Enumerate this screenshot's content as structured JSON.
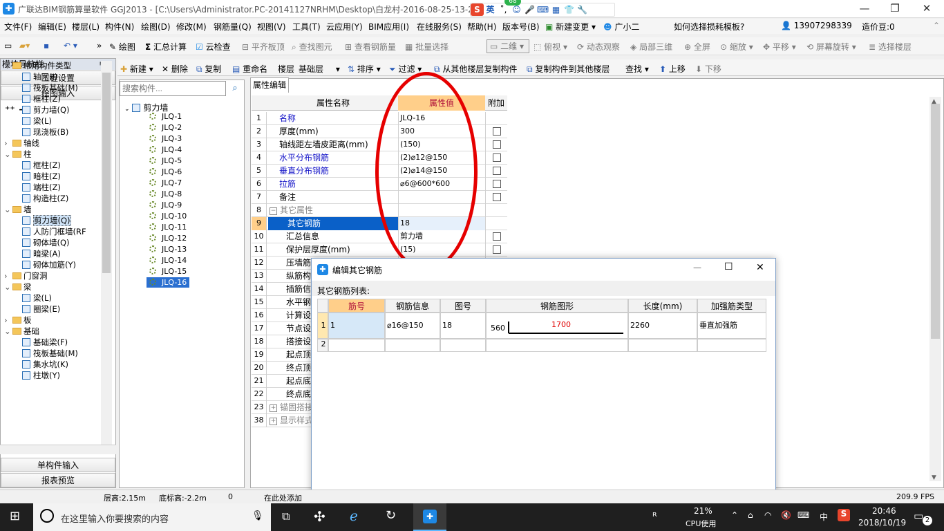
{
  "window": {
    "app_icon": "GLD-icon",
    "title": "广联达BIM钢筋算量软件 GGJ2013 - [C:\\Users\\Administrator.PC-20141127NRHM\\Desktop\\白龙村-2016-08-25-13-27",
    "min": "—",
    "restore": "❐",
    "close": "✕"
  },
  "ime": {
    "logo": "S",
    "lang": "英",
    "badge": "68"
  },
  "menu": {
    "items": [
      "文件(F)",
      "编辑(E)",
      "楼层(L)",
      "构件(N)",
      "绘图(D)",
      "修改(M)",
      "钢筋量(Q)",
      "视图(V)",
      "工具(T)",
      "云应用(Y)",
      "BIM应用(I)",
      "在线服务(S)",
      "帮助(H)",
      "版本号(B)"
    ],
    "new_change": "新建变更",
    "assistant": "广小二",
    "question": "如何选择损耗模板?",
    "phone": "13907298339",
    "price_bean": "造价豆:0"
  },
  "toolbar1": {
    "draw": "绘图",
    "sum": "汇总计算",
    "cloud_check": "云检查",
    "align_slab_top": "平齐板顶",
    "find_elem": "查找图元",
    "view_rebar": "查看钢筋量",
    "batch_select": "批量选择",
    "view_mode": "二维",
    "top_view": "俯视",
    "dynamic_view": "动态观察",
    "local_3d": "局部三维",
    "fullscreen": "全屏",
    "zoom": "缩放",
    "pan": "平移",
    "rotate": "屏幕旋转",
    "select_floor": "选择楼层"
  },
  "toolbar2": {
    "new": "新建",
    "delete": "删除",
    "copy": "复制",
    "rename": "重命名",
    "floor_label": "楼层",
    "floor_value": "基础层",
    "sort": "排序",
    "filter": "过滤",
    "copy_from_floor": "从其他楼层复制构件",
    "copy_to_floor": "复制构件到其他楼层",
    "find": "查找",
    "move_up": "上移",
    "move_down": "下移"
  },
  "nav": {
    "title": "模块导航栏",
    "pin": "ᵖ ×",
    "project_settings": "工程设置",
    "drawing_input": "绘图输入",
    "single_input": "单构件输入",
    "report_preview": "报表预览",
    "tree": [
      {
        "label": "常用构件类型",
        "level": 0,
        "type": "folder",
        "exp": "⌄"
      },
      {
        "label": "轴网(J)",
        "level": 1,
        "type": "item"
      },
      {
        "label": "筏板基础(M)",
        "level": 1,
        "type": "item"
      },
      {
        "label": "框柱(Z)",
        "level": 1,
        "type": "item"
      },
      {
        "label": "剪力墙(Q)",
        "level": 1,
        "type": "item"
      },
      {
        "label": "梁(L)",
        "level": 1,
        "type": "item"
      },
      {
        "label": "现浇板(B)",
        "level": 1,
        "type": "item"
      },
      {
        "label": "轴线",
        "level": 0,
        "type": "folder",
        "exp": "›"
      },
      {
        "label": "柱",
        "level": 0,
        "type": "folder",
        "exp": "⌄"
      },
      {
        "label": "框柱(Z)",
        "level": 1,
        "type": "item"
      },
      {
        "label": "暗柱(Z)",
        "level": 1,
        "type": "item"
      },
      {
        "label": "端柱(Z)",
        "level": 1,
        "type": "item"
      },
      {
        "label": "构造柱(Z)",
        "level": 1,
        "type": "item"
      },
      {
        "label": "墙",
        "level": 0,
        "type": "folder",
        "exp": "⌄"
      },
      {
        "label": "剪力墙(Q)",
        "level": 1,
        "type": "item",
        "selected": true
      },
      {
        "label": "人防门框墙(RF",
        "level": 1,
        "type": "item"
      },
      {
        "label": "砌体墙(Q)",
        "level": 1,
        "type": "item"
      },
      {
        "label": "暗梁(A)",
        "level": 1,
        "type": "item"
      },
      {
        "label": "砌体加筋(Y)",
        "level": 1,
        "type": "item"
      },
      {
        "label": "门窗洞",
        "level": 0,
        "type": "folder",
        "exp": "›"
      },
      {
        "label": "梁",
        "level": 0,
        "type": "folder",
        "exp": "⌄"
      },
      {
        "label": "梁(L)",
        "level": 1,
        "type": "item"
      },
      {
        "label": "圈梁(E)",
        "level": 1,
        "type": "item"
      },
      {
        "label": "板",
        "level": 0,
        "type": "folder",
        "exp": "›"
      },
      {
        "label": "基础",
        "level": 0,
        "type": "folder",
        "exp": "⌄"
      },
      {
        "label": "基础梁(F)",
        "level": 1,
        "type": "item"
      },
      {
        "label": "筏板基础(M)",
        "level": 1,
        "type": "item"
      },
      {
        "label": "集水坑(K)",
        "level": 1,
        "type": "item"
      },
      {
        "label": "柱墩(Y)",
        "level": 1,
        "type": "item"
      }
    ]
  },
  "components": {
    "search_placeholder": "搜索构件...",
    "root": "剪力墙",
    "items": [
      "JLQ-1",
      "JLQ-2",
      "JLQ-3",
      "JLQ-4",
      "JLQ-5",
      "JLQ-6",
      "JLQ-7",
      "JLQ-8",
      "JLQ-9",
      "JLQ-10",
      "JLQ-11",
      "JLQ-12",
      "JLQ-13",
      "JLQ-14",
      "JLQ-15",
      "JLQ-16"
    ],
    "selected": "JLQ-16"
  },
  "props": {
    "tab": "属性编辑",
    "col_name": "属性名称",
    "col_value": "属性值",
    "col_extra": "附加",
    "rows": [
      {
        "n": "1",
        "name": "名称",
        "value": "JLQ-16",
        "blue": true,
        "cb": false
      },
      {
        "n": "2",
        "name": "厚度(mm)",
        "value": "300",
        "cb": true
      },
      {
        "n": "3",
        "name": "轴线距左墙皮距离(mm)",
        "value": "(150)",
        "cb": true
      },
      {
        "n": "4",
        "name": "水平分布钢筋",
        "value": "(2)⌀12@150",
        "blue": true,
        "cb": true
      },
      {
        "n": "5",
        "name": "垂直分布钢筋",
        "value": "(2)⌀14@150",
        "blue": true,
        "cb": true
      },
      {
        "n": "6",
        "name": "拉筋",
        "value": "⌀6@600*600",
        "blue": true,
        "cb": true
      },
      {
        "n": "7",
        "name": "备注",
        "value": "",
        "cb": true
      },
      {
        "n": "8",
        "name": "其它属性",
        "value": "",
        "group": true,
        "expander": "−"
      },
      {
        "n": "9",
        "name": "其它钢筋",
        "value": "18",
        "selected": true,
        "sub": true
      },
      {
        "n": "10",
        "name": "汇总信息",
        "value": "剪力墙",
        "cb": true,
        "sub": true
      },
      {
        "n": "11",
        "name": "保护层厚度(mm)",
        "value": "(15)",
        "cb": true,
        "sub": true
      },
      {
        "n": "12",
        "name": "压墙筋",
        "value": "",
        "sub": true
      },
      {
        "n": "13",
        "name": "纵筋构",
        "value": "",
        "sub": true
      },
      {
        "n": "14",
        "name": "插筋信",
        "value": "",
        "sub": true
      },
      {
        "n": "15",
        "name": "水平钢",
        "value": "",
        "sub": true
      },
      {
        "n": "16",
        "name": "计算设",
        "value": "",
        "sub": true
      },
      {
        "n": "17",
        "name": "节点设",
        "value": "",
        "sub": true
      },
      {
        "n": "18",
        "name": "搭接设",
        "value": "",
        "sub": true
      },
      {
        "n": "19",
        "name": "起点顶",
        "value": "",
        "sub": true
      },
      {
        "n": "20",
        "name": "终点顶",
        "value": "",
        "sub": true
      },
      {
        "n": "21",
        "name": "起点底",
        "value": "",
        "sub": true
      },
      {
        "n": "22",
        "name": "终点底",
        "value": "",
        "sub": true
      },
      {
        "n": "23",
        "name": "锚固搭接",
        "value": "",
        "group": true,
        "expander": "+"
      },
      {
        "n": "38",
        "name": "显示样式",
        "value": "",
        "group": true,
        "expander": "+"
      }
    ]
  },
  "dialog": {
    "title": "编辑其它钢筋",
    "list_label": "其它钢筋列表:",
    "headers": [
      "筋号",
      "钢筋信息",
      "图号",
      "钢筋图形",
      "长度(mm)",
      "加强筋类型"
    ],
    "rows": [
      {
        "n": "1",
        "bar_no": "1",
        "info": "⌀16@150",
        "fig_no": "18",
        "shape_left": "560",
        "shape_dim": "1700",
        "length": "2260",
        "type": "垂直加强筋"
      },
      {
        "n": "2",
        "bar_no": "",
        "info": "",
        "fig_no": "",
        "shape_left": "",
        "shape_dim": "",
        "length": "",
        "type": ""
      }
    ],
    "min": "—",
    "max": "☐",
    "close": "✕"
  },
  "status": {
    "floor_height": "层高:2.15m",
    "base_height": "底标高:-2.2m",
    "zero": "0",
    "hint": "在此处添加",
    "fps": "209.9 FPS"
  },
  "taskbar": {
    "search": "在这里输入你要搜索的内容",
    "cpu_pct": "21%",
    "cpu_label": "CPU使用",
    "ime_lang": "中",
    "time": "20:46",
    "date": "2018/10/19",
    "notif": "2"
  }
}
